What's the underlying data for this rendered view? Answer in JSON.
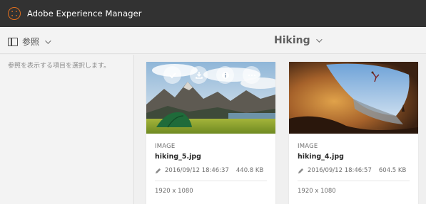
{
  "app": {
    "title": "Adobe Experience Manager"
  },
  "toolbar": {
    "rail_label": "参照",
    "page_title": "Hiking"
  },
  "rail": {
    "hint": "参照を表示する項目を選択します。"
  },
  "cards": [
    {
      "type": "IMAGE",
      "name": "hiking_5.jpg",
      "date": "2016/09/12 18:46:37",
      "size": "440.8 KB",
      "dimensions": "1920 x 1080"
    },
    {
      "type": "IMAGE",
      "name": "hiking_4.jpg",
      "date": "2016/09/12 18:46:57",
      "size": "604.5 KB",
      "dimensions": "1920 x 1080"
    }
  ],
  "quick_actions": [
    "select-icon",
    "download-icon",
    "info-icon",
    "more-icon"
  ],
  "colors": {
    "topbar": "#323232",
    "accent": "#e1701f",
    "background": "#f0f0f0"
  }
}
